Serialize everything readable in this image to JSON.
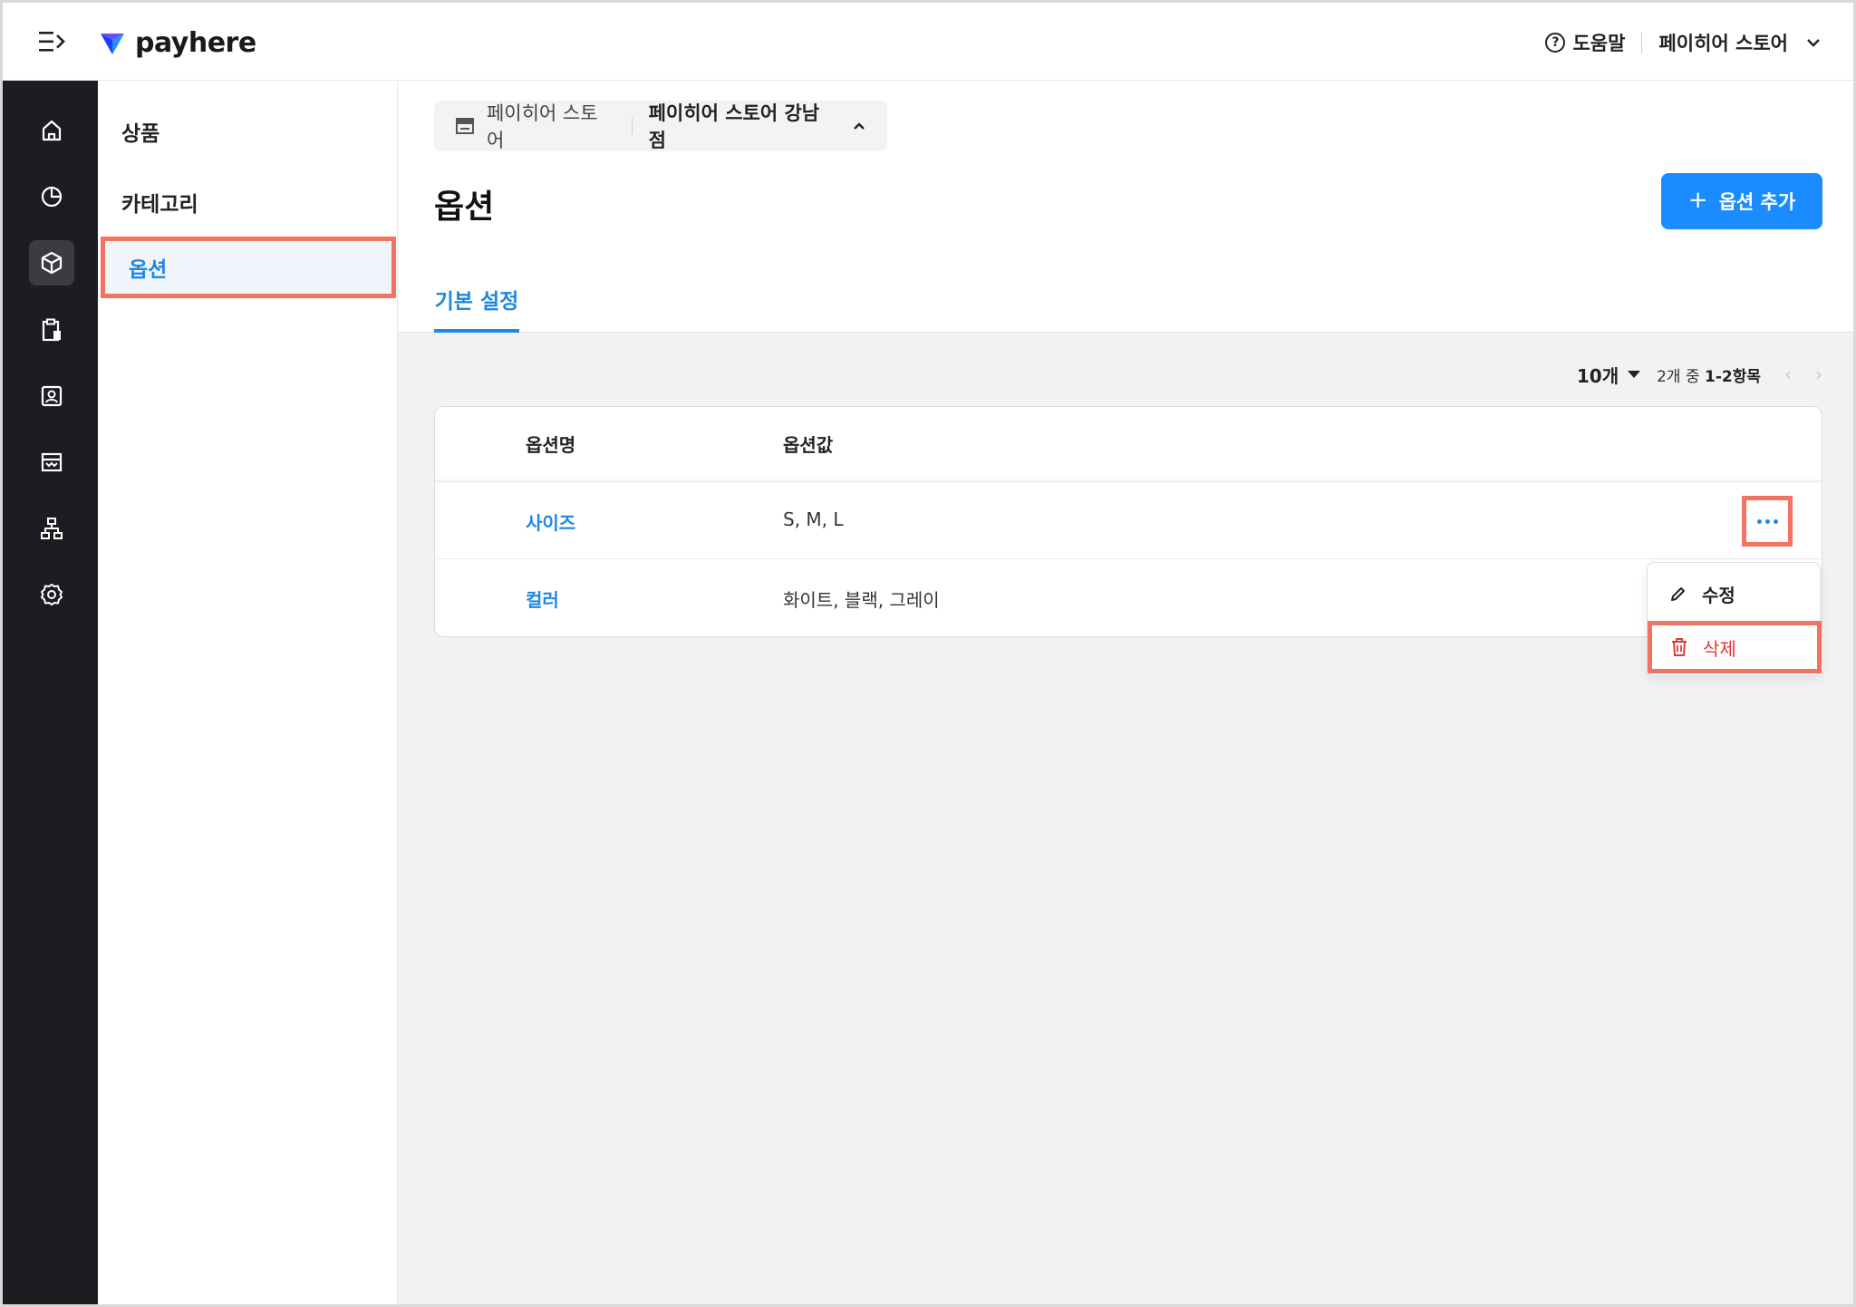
{
  "header": {
    "brand": "payhere",
    "help_label": "도움말",
    "store_name": "페이히어 스토어"
  },
  "rail": {
    "items": [
      "home-icon",
      "chart-pie-icon",
      "cube-icon",
      "clipboard-icon",
      "contact-icon",
      "store-icon",
      "org-chart-icon",
      "gear-icon"
    ],
    "active_index": 2
  },
  "subnav": {
    "items": [
      {
        "label": "상품"
      },
      {
        "label": "카테고리"
      },
      {
        "label": "옵션"
      }
    ],
    "active_index": 2
  },
  "main": {
    "breadcrumb": {
      "parent": "페이히어 스토어",
      "current": "페이히어 스토어 강남점"
    },
    "title": "옵션",
    "add_button": "옵션 추가",
    "tab": "기본 설정",
    "pager": {
      "page_size": "10개",
      "range_prefix": "2개 중",
      "range": "1-2항목"
    },
    "table": {
      "columns": [
        "옵션명",
        "옵션값"
      ],
      "rows": [
        {
          "name": "사이즈",
          "values": "S, M, L"
        },
        {
          "name": "컬러",
          "values": "화이트, 블랙, 그레이"
        }
      ]
    },
    "row_menu": {
      "edit": "수정",
      "delete": "삭제"
    }
  },
  "colors": {
    "accent": "#1a8cff",
    "link": "#1e88e5",
    "highlight": "#f47262",
    "danger": "#e53935",
    "rail_bg": "#1c1d21"
  }
}
